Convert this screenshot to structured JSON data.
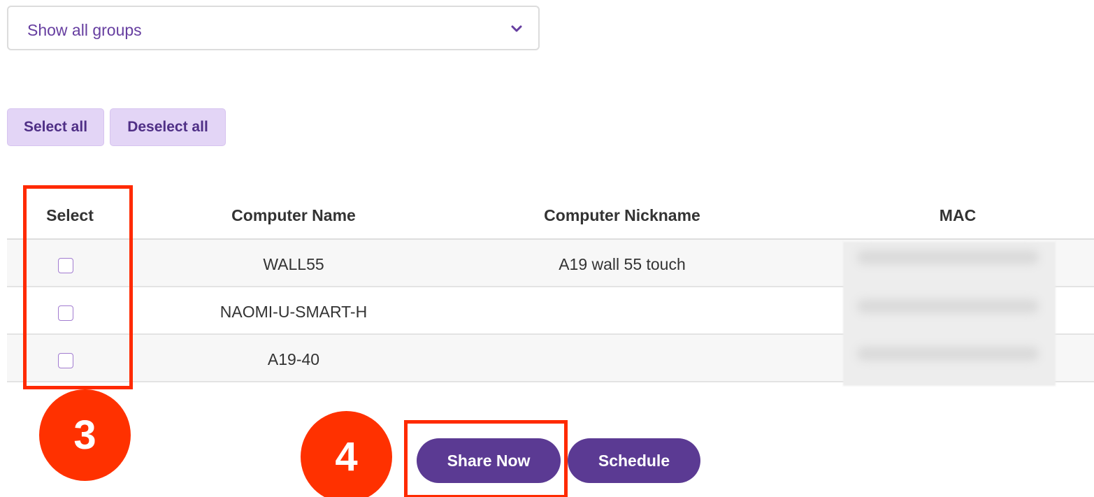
{
  "group_filter": {
    "selected": "Show all groups"
  },
  "buttons": {
    "select_all": "Select all",
    "deselect_all": "Deselect all",
    "share_now": "Share Now",
    "schedule": "Schedule"
  },
  "table": {
    "headers": {
      "select": "Select",
      "computer_name": "Computer Name",
      "computer_nickname": "Computer Nickname",
      "mac": "MAC"
    },
    "rows": [
      {
        "computer_name": "WALL55",
        "computer_nickname": "A19 wall 55 touch",
        "checked": false
      },
      {
        "computer_name": "NAOMI-U-SMART-H",
        "computer_nickname": "",
        "checked": false
      },
      {
        "computer_name": "A19-40",
        "computer_nickname": "",
        "checked": false
      }
    ]
  },
  "annotations": {
    "step_3": "3",
    "step_4": "4"
  },
  "colors": {
    "accent": "#5b3a93",
    "light_accent": "#e3d5f6",
    "annotation": "#ff3100"
  }
}
